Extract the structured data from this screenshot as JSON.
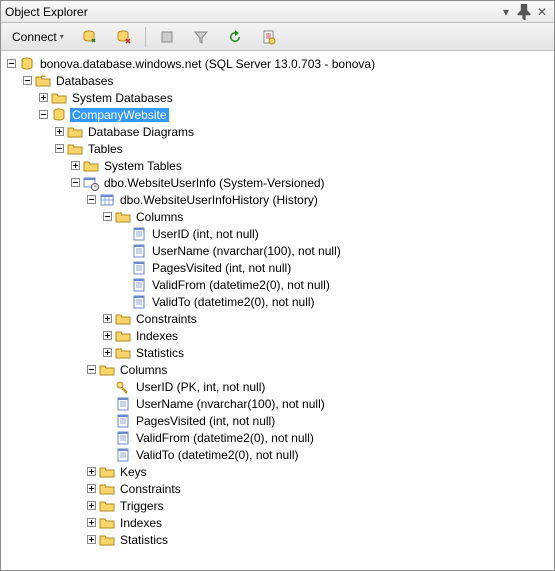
{
  "panel": {
    "title": "Object Explorer"
  },
  "toolbar": {
    "connect": "Connect"
  },
  "tree": {
    "server": "bonova.database.windows.net (SQL Server 13.0.703 - bonova)",
    "databases": "Databases",
    "sysdb": "System Databases",
    "company": "CompanyWebsite",
    "diagrams": "Database Diagrams",
    "tables": "Tables",
    "systables": "System Tables",
    "userinfo": "dbo.WebsiteUserInfo (System-Versioned)",
    "history": "dbo.WebsiteUserInfoHistory (History)",
    "columns": "Columns",
    "h_userid": "UserID (int, not null)",
    "h_username": "UserName (nvarchar(100), not null)",
    "h_pages": "PagesVisited (int, not null)",
    "h_validfrom": "ValidFrom (datetime2(0), not null)",
    "h_validto": "ValidTo (datetime2(0), not null)",
    "constraints": "Constraints",
    "indexes": "Indexes",
    "statistics": "Statistics",
    "m_userid": "UserID (PK, int, not null)",
    "m_username": "UserName (nvarchar(100), not null)",
    "m_pages": "PagesVisited (int, not null)",
    "m_validfrom": "ValidFrom (datetime2(0), not null)",
    "m_validto": "ValidTo (datetime2(0), not null)",
    "keys": "Keys",
    "triggers": "Triggers"
  }
}
